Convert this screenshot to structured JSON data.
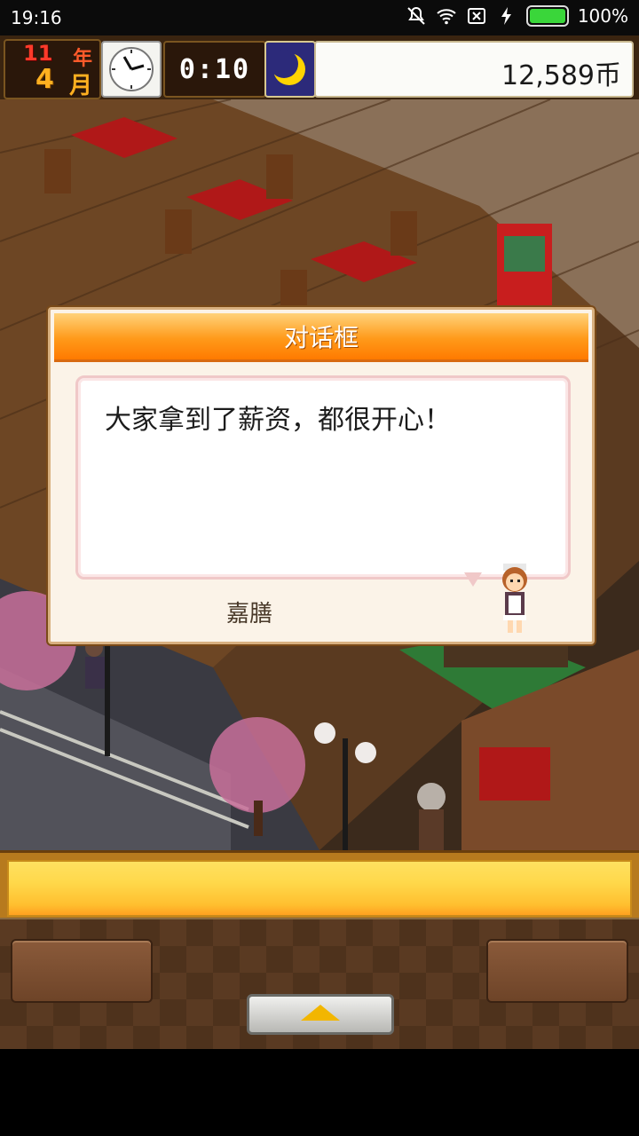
{
  "status_bar": {
    "time": "19:16",
    "battery": "100%",
    "icons": [
      "mute-icon",
      "wifi-icon",
      "sim-icon",
      "charging-icon",
      "battery-icon"
    ]
  },
  "hud": {
    "year_num": "11",
    "year_unit": "年",
    "month_num": "4",
    "month_unit": "月",
    "game_time": "0:10",
    "time_of_day_icon": "moon-icon",
    "money": "12,589币"
  },
  "dialog": {
    "title": "对话框",
    "message": "大家拿到了薪资，都很开心！",
    "speaker": "嘉膳"
  },
  "bottom": {
    "expand_icon": "arrow-up-icon"
  },
  "colors": {
    "header_orange": "#ff8a10",
    "money_bg": "#fbfbf8",
    "bottom_yellow": "#ffd84a"
  }
}
